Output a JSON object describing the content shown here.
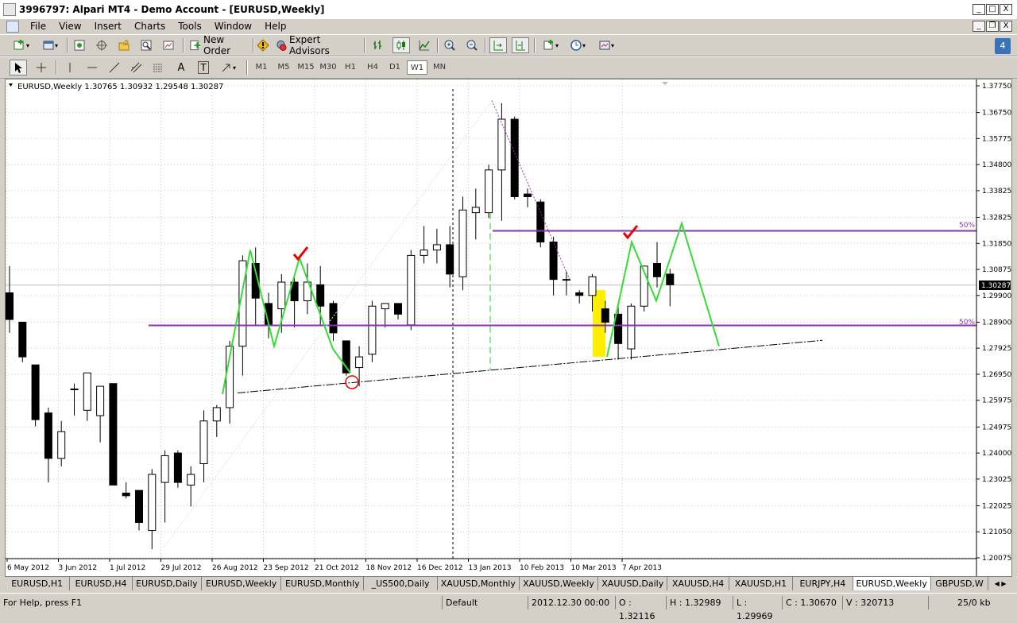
{
  "window": {
    "title": "3996797: Alpari MT4 - Demo Account - [EURUSD,Weekly]",
    "minimize": "_",
    "restore": "□",
    "close": "X"
  },
  "menu": {
    "items": [
      "File",
      "View",
      "Insert",
      "Charts",
      "Tools",
      "Window",
      "Help"
    ]
  },
  "mdi": {
    "minimize": "_",
    "restore": "❐",
    "close": "X"
  },
  "toolbar": {
    "new_order": "New Order",
    "expert_advisors": "Expert Advisors",
    "notification_count": "4"
  },
  "drawing_tools": {
    "text_tool": "A",
    "label_tool": "T"
  },
  "timeframes": [
    "M1",
    "M5",
    "M15",
    "M30",
    "H1",
    "H4",
    "D1",
    "W1",
    "MN"
  ],
  "active_timeframe": "W1",
  "chart": {
    "header": "EURUSD,Weekly  1.30765 1.30932 1.29548 1.30287",
    "current_price": "1.30287",
    "level_label_upper": "50%",
    "level_label_lower": "50%",
    "price_ticks": [
      "1.37750",
      "1.36750",
      "1.35775",
      "1.34800",
      "1.33825",
      "1.32825",
      "1.31850",
      "1.30875",
      "1.29900",
      "1.28900",
      "1.27925",
      "1.26950",
      "1.25975",
      "1.24975",
      "1.24000",
      "1.23025",
      "1.22025",
      "1.21050",
      "1.20075"
    ],
    "date_ticks": [
      "6 May 2012",
      "3 Jun 2012",
      "1 Jul 2012",
      "29 Jul 2012",
      "26 Aug 2012",
      "23 Sep 2012",
      "21 Oct 2012",
      "18 Nov 2012",
      "16 Dec 2012",
      "13 Jan 2013",
      "10 Feb 2013",
      "10 Mar 2013",
      "7 Apr 2013"
    ],
    "colors": {
      "bull": "#ffffff",
      "bear": "#000000",
      "pattern": "#33dd33",
      "level": "#8833aa",
      "highlight": "#ffee00",
      "check": "#ee0000",
      "dashed_green": "#22cc22"
    }
  },
  "chart_data": {
    "type": "candlestick",
    "title": "EURUSD,Weekly",
    "ohlc_header": [
      1.30765,
      1.30932,
      1.29548,
      1.30287
    ],
    "ylim": [
      1.20075,
      1.3775
    ],
    "candles": [
      {
        "o": 1.3,
        "h": 1.31,
        "l": 1.285,
        "c": 1.29
      },
      {
        "o": 1.289,
        "h": 1.289,
        "l": 1.274,
        "c": 1.276
      },
      {
        "o": 1.273,
        "h": 1.273,
        "l": 1.25,
        "c": 1.2525
      },
      {
        "o": 1.255,
        "h": 1.257,
        "l": 1.229,
        "c": 1.238
      },
      {
        "o": 1.238,
        "h": 1.252,
        "l": 1.235,
        "c": 1.248
      },
      {
        "o": 1.264,
        "h": 1.266,
        "l": 1.254,
        "c": 1.264
      },
      {
        "o": 1.256,
        "h": 1.27,
        "l": 1.252,
        "c": 1.27
      },
      {
        "o": 1.254,
        "h": 1.263,
        "l": 1.244,
        "c": 1.265
      },
      {
        "o": 1.266,
        "h": 1.266,
        "l": 1.228,
        "c": 1.228
      },
      {
        "o": 1.225,
        "h": 1.229,
        "l": 1.223,
        "c": 1.224
      },
      {
        "o": 1.226,
        "h": 1.226,
        "l": 1.211,
        "c": 1.214
      },
      {
        "o": 1.211,
        "h": 1.234,
        "l": 1.204,
        "c": 1.232
      },
      {
        "o": 1.229,
        "h": 1.241,
        "l": 1.214,
        "c": 1.239
      },
      {
        "o": 1.24,
        "h": 1.241,
        "l": 1.227,
        "c": 1.229
      },
      {
        "o": 1.228,
        "h": 1.235,
        "l": 1.22,
        "c": 1.232
      },
      {
        "o": 1.236,
        "h": 1.256,
        "l": 1.229,
        "c": 1.252
      },
      {
        "o": 1.252,
        "h": 1.258,
        "l": 1.246,
        "c": 1.257
      },
      {
        "o": 1.257,
        "h": 1.282,
        "l": 1.251,
        "c": 1.28
      },
      {
        "o": 1.28,
        "h": 1.314,
        "l": 1.269,
        "c": 1.312
      },
      {
        "o": 1.311,
        "h": 1.317,
        "l": 1.288,
        "c": 1.298
      },
      {
        "o": 1.296,
        "h": 1.3,
        "l": 1.283,
        "c": 1.288
      },
      {
        "o": 1.294,
        "h": 1.307,
        "l": 1.285,
        "c": 1.304
      },
      {
        "o": 1.304,
        "h": 1.306,
        "l": 1.287,
        "c": 1.297
      },
      {
        "o": 1.297,
        "h": 1.311,
        "l": 1.292,
        "c": 1.304
      },
      {
        "o": 1.303,
        "h": 1.31,
        "l": 1.288,
        "c": 1.295
      },
      {
        "o": 1.296,
        "h": 1.297,
        "l": 1.282,
        "c": 1.285
      },
      {
        "o": 1.282,
        "h": 1.282,
        "l": 1.269,
        "c": 1.27
      },
      {
        "o": 1.272,
        "h": 1.28,
        "l": 1.265,
        "c": 1.276
      },
      {
        "o": 1.277,
        "h": 1.297,
        "l": 1.274,
        "c": 1.295
      },
      {
        "o": 1.294,
        "h": 1.296,
        "l": 1.287,
        "c": 1.296
      },
      {
        "o": 1.296,
        "h": 1.296,
        "l": 1.29,
        "c": 1.292
      },
      {
        "o": 1.288,
        "h": 1.316,
        "l": 1.286,
        "c": 1.314
      },
      {
        "o": 1.314,
        "h": 1.325,
        "l": 1.311,
        "c": 1.316
      },
      {
        "o": 1.316,
        "h": 1.324,
        "l": 1.311,
        "c": 1.318
      },
      {
        "o": 1.318,
        "h": 1.325,
        "l": 1.302,
        "c": 1.307
      },
      {
        "o": 1.306,
        "h": 1.336,
        "l": 1.301,
        "c": 1.331
      },
      {
        "o": 1.33,
        "h": 1.339,
        "l": 1.32,
        "c": 1.332
      },
      {
        "o": 1.33,
        "h": 1.348,
        "l": 1.328,
        "c": 1.346
      },
      {
        "o": 1.346,
        "h": 1.371,
        "l": 1.327,
        "c": 1.365
      },
      {
        "o": 1.365,
        "h": 1.366,
        "l": 1.335,
        "c": 1.336
      },
      {
        "o": 1.337,
        "h": 1.339,
        "l": 1.332,
        "c": 1.336
      },
      {
        "o": 1.334,
        "h": 1.335,
        "l": 1.317,
        "c": 1.319
      },
      {
        "o": 1.319,
        "h": 1.321,
        "l": 1.299,
        "c": 1.305
      },
      {
        "o": 1.305,
        "h": 1.308,
        "l": 1.299,
        "c": 1.305
      },
      {
        "o": 1.3,
        "h": 1.301,
        "l": 1.296,
        "c": 1.299
      },
      {
        "o": 1.299,
        "h": 1.307,
        "l": 1.293,
        "c": 1.306
      },
      {
        "o": 1.294,
        "h": 1.297,
        "l": 1.285,
        "c": 1.289
      },
      {
        "o": 1.292,
        "h": 1.295,
        "l": 1.275,
        "c": 1.281
      },
      {
        "o": 1.279,
        "h": 1.296,
        "l": 1.275,
        "c": 1.295
      },
      {
        "o": 1.295,
        "h": 1.31,
        "l": 1.293,
        "c": 1.31
      },
      {
        "o": 1.311,
        "h": 1.319,
        "l": 1.302,
        "c": 1.306
      },
      {
        "o": 1.307,
        "h": 1.309,
        "l": 1.295,
        "c": 1.303
      }
    ]
  },
  "tabs": [
    "EURUSD,H1",
    "EURUSD,H4",
    "EURUSD,Daily",
    "EURUSD,Weekly",
    "EURUSD,Monthly",
    "_US500,Daily",
    "XAUUSD,Monthly",
    "XAUUSD,Weekly",
    "XAUUSD,Daily",
    "XAUUSD,H4",
    "XAUUSD,H1",
    "EURJPY,H4",
    "EURUSD,Weekly",
    "GBPUSD,W"
  ],
  "active_tab_index": 12,
  "status": {
    "help": "For Help, press F1",
    "profile": "Default",
    "datetime": "2012.12.30 00:00",
    "open": "O : 1.32116",
    "high": "H : 1.32989",
    "low": "L : 1.29969",
    "close": "C : 1.30670",
    "volume": "V : 320713",
    "traffic": "25/0 kb"
  }
}
